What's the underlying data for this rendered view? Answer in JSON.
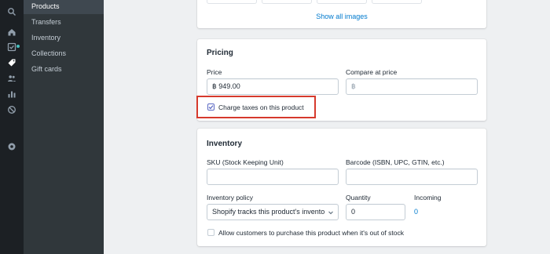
{
  "rail": {
    "icons": [
      "search-icon",
      "home-icon",
      "orders-icon",
      "products-icon",
      "customers-icon",
      "analytics-icon",
      "discounts-icon",
      "apps-icon"
    ],
    "notification_color": "#47c1bf"
  },
  "nav": {
    "items": [
      {
        "label": "Products"
      },
      {
        "label": "Transfers"
      },
      {
        "label": "Inventory"
      },
      {
        "label": "Collections"
      },
      {
        "label": "Gift cards"
      }
    ]
  },
  "images": {
    "show_all": "Show all images"
  },
  "pricing": {
    "title": "Pricing",
    "price_label": "Price",
    "price_value": "฿ 949.00",
    "compare_label": "Compare at price",
    "compare_placeholder": "฿",
    "charge_taxes_label": "Charge taxes on this product",
    "charge_taxes_checked": true
  },
  "inventory": {
    "title": "Inventory",
    "sku_label": "SKU (Stock Keeping Unit)",
    "sku_value": "",
    "barcode_label": "Barcode (ISBN, UPC, GTIN, etc.)",
    "barcode_value": "",
    "policy_label": "Inventory policy",
    "policy_value": "Shopify tracks this product's invento",
    "quantity_label": "Quantity",
    "quantity_value": "0",
    "incoming_label": "Incoming",
    "incoming_value": "0",
    "oversell_label": "Allow customers to purchase this product when it's out of stock",
    "oversell_checked": false
  },
  "colors": {
    "accent": "#5c6ac4",
    "link": "#007ace",
    "highlight": "#d63a2d"
  }
}
